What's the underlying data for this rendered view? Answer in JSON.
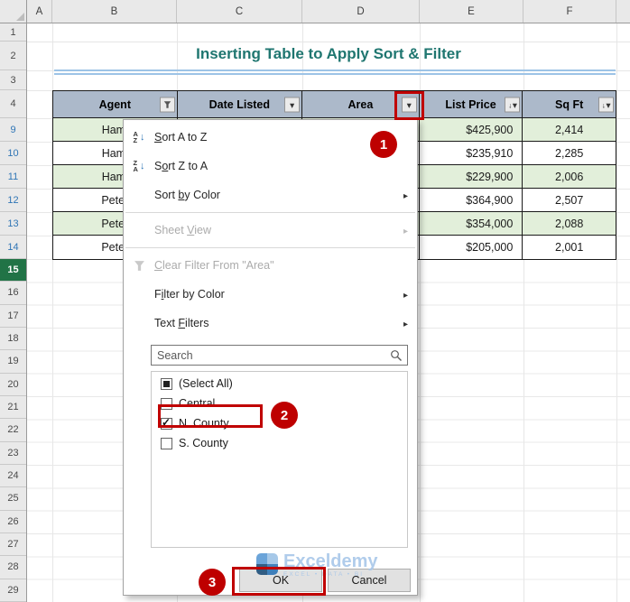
{
  "title": "Inserting Table to Apply Sort & Filter",
  "grid": {
    "column_letters": [
      "A",
      "B",
      "C",
      "D",
      "E",
      "F"
    ],
    "row_numbers": [
      "1",
      "2",
      "3",
      "4",
      "9",
      "10",
      "11",
      "12",
      "13",
      "14",
      "15",
      "16",
      "17",
      "18",
      "19",
      "20",
      "21",
      "22",
      "23",
      "24",
      "25",
      "26",
      "27",
      "28",
      "29"
    ]
  },
  "table": {
    "headers": [
      "Agent",
      "Date Listed",
      "Area",
      "List Price",
      "Sq Ft"
    ],
    "rows": [
      {
        "agent": "Hami",
        "list_price": "$425,900",
        "sq_ft": "2,414"
      },
      {
        "agent": "Hami",
        "list_price": "$235,910",
        "sq_ft": "2,285"
      },
      {
        "agent": "Hami",
        "list_price": "$229,900",
        "sq_ft": "2,006"
      },
      {
        "agent": "Peter",
        "list_price": "$364,900",
        "sq_ft": "2,507"
      },
      {
        "agent": "Peter",
        "list_price": "$354,000",
        "sq_ft": "2,088"
      },
      {
        "agent": "Peter",
        "list_price": "$205,000",
        "sq_ft": "2,001"
      }
    ]
  },
  "filter_menu": {
    "items": [
      {
        "pre": "",
        "key": "S",
        "post": "ort A to Z"
      },
      {
        "pre": "S",
        "key": "o",
        "post": "rt Z to A"
      },
      {
        "pre": "Sort ",
        "key": "b",
        "post": "y Color"
      },
      {
        "pre": "Sheet ",
        "key": "V",
        "post": "iew"
      },
      {
        "pre": "",
        "key": "C",
        "post": "lear Filter From \"Area\""
      },
      {
        "pre": "F",
        "key": "i",
        "post": "lter by Color"
      },
      {
        "pre": "Text ",
        "key": "F",
        "post": "ilters"
      }
    ],
    "search_placeholder": "Search",
    "checkboxes": [
      {
        "label": "(Select All)",
        "state": "indeterminate"
      },
      {
        "label": "Central",
        "state": "unchecked"
      },
      {
        "label": "N. County",
        "state": "checked"
      },
      {
        "label": "S. County",
        "state": "unchecked"
      }
    ],
    "ok_label": "OK",
    "cancel_label": "Cancel"
  },
  "annotations": {
    "step1": "1",
    "step2": "2",
    "step3": "3"
  },
  "watermark": {
    "brand": "Exceldemy",
    "tagline": "EXCEL • DATA • BI"
  },
  "colors": {
    "annotation_red": "#C00000",
    "title_teal": "#1F7670",
    "table_header_fill": "#ACB9CA",
    "band_green": "#E2EFDA",
    "filtered_row_number_blue": "#2F75B5",
    "active_row_green": "#217346"
  }
}
